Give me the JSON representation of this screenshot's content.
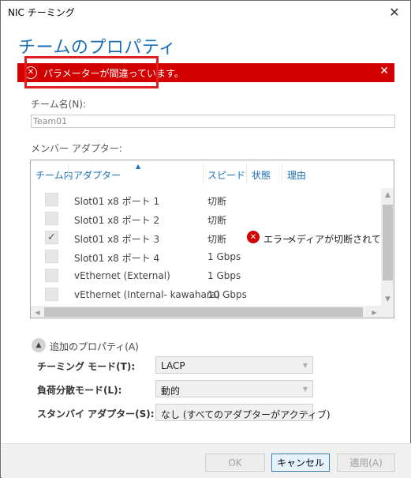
{
  "window": {
    "title": "NIC チーミング",
    "close_glyph": "✕"
  },
  "heading": "チームのプロパティ",
  "error": {
    "message": "パラメーターが間違っています。",
    "icon": "error-circle-icon",
    "color": "#d30000"
  },
  "team_name": {
    "label": "チーム名(N):",
    "value": "Team01"
  },
  "member_adapters": {
    "label": "メンバー アダプター:",
    "columns": [
      "チーム内",
      "アダプター",
      "スピード",
      "状態",
      "理由"
    ],
    "rows": [
      {
        "checked": false,
        "adapter": "Slot01 x8 ポート 1",
        "speed": "切断",
        "status": "",
        "reason": ""
      },
      {
        "checked": false,
        "adapter": "Slot01 x8 ポート 2",
        "speed": "切断",
        "status": "",
        "reason": ""
      },
      {
        "checked": true,
        "adapter": "Slot01 x8 ポート 3",
        "speed": "切断",
        "status": "エラー",
        "reason": "メディアが切断されています"
      },
      {
        "checked": false,
        "adapter": "Slot01 x8 ポート 4",
        "speed": "1 Gbps",
        "status": "",
        "reason": ""
      },
      {
        "checked": false,
        "adapter": "vEthernet (External)",
        "speed": "1 Gbps",
        "status": "",
        "reason": ""
      },
      {
        "checked": false,
        "adapter": "vEthernet (Internal- kawahara)",
        "speed": "10 Gbps",
        "status": "",
        "reason": ""
      }
    ]
  },
  "additional_properties": {
    "toggle_label": "追加のプロパティ(A)",
    "teaming_mode": {
      "label": "チーミング モード(T):",
      "value": "LACP"
    },
    "load_balancing": {
      "label": "負荷分散モード(L):",
      "value": "動的"
    },
    "standby_adapter": {
      "label": "スタンバイ アダプター(S):",
      "value": "なし (すべてのアダプターがアクティブ)"
    }
  },
  "buttons": {
    "ok": "OK",
    "cancel": "キャンセル",
    "apply": "適用(A)"
  },
  "colors": {
    "accent": "#1b6fb5",
    "error": "#d30000"
  }
}
